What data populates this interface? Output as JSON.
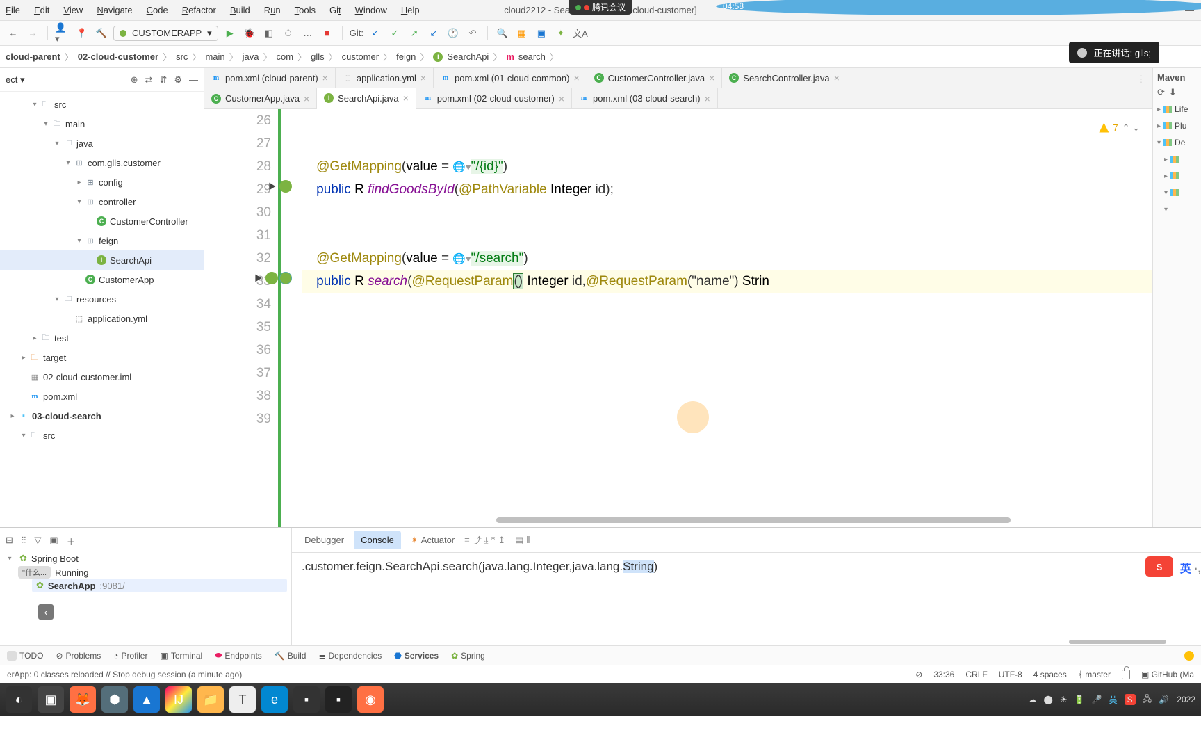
{
  "menu": {
    "file": "File",
    "edit": "Edit",
    "view": "View",
    "navigate": "Navigate",
    "code": "Code",
    "refactor": "Refactor",
    "build": "Build",
    "run": "Run",
    "tools": "Tools",
    "git": "Git",
    "window": "Window",
    "help": "Help"
  },
  "window_title": "cloud2212 - SearchApi.java [02-cloud-customer]",
  "overlay": {
    "text": "腾讯会议"
  },
  "mic_bar": "正在讲话: glls;",
  "time_badge": "04:58",
  "run_config": "CUSTOMERAPP",
  "git_label": "Git:",
  "breadcrumb": [
    "cloud-parent",
    "02-cloud-customer",
    "src",
    "main",
    "java",
    "com",
    "glls",
    "customer",
    "feign",
    "SearchApi",
    "search"
  ],
  "project_dd": "ect",
  "tree": [
    {
      "d": 1,
      "tw": "▾",
      "icon": "folder",
      "label": "src",
      "bold": false
    },
    {
      "d": 2,
      "tw": "▾",
      "icon": "folder",
      "label": "main",
      "bold": false
    },
    {
      "d": 3,
      "tw": "▾",
      "icon": "folder",
      "label": "java",
      "bold": false
    },
    {
      "d": 4,
      "tw": "▾",
      "icon": "pkg",
      "label": "com.glls.customer",
      "bold": false
    },
    {
      "d": 5,
      "tw": "▸",
      "icon": "pkg",
      "label": "config",
      "bold": false
    },
    {
      "d": 5,
      "tw": "▾",
      "icon": "pkg",
      "label": "controller",
      "bold": false
    },
    {
      "d": 6,
      "tw": "",
      "icon": "class",
      "label": "CustomerController",
      "bold": false
    },
    {
      "d": 5,
      "tw": "▾",
      "icon": "pkg",
      "label": "feign",
      "bold": false
    },
    {
      "d": 6,
      "tw": "",
      "icon": "iface",
      "label": "SearchApi",
      "bold": false,
      "sel": true
    },
    {
      "d": 5,
      "tw": "",
      "icon": "class",
      "label": "CustomerApp",
      "bold": false
    },
    {
      "d": 3,
      "tw": "▾",
      "icon": "folder",
      "label": "resources",
      "bold": false
    },
    {
      "d": 4,
      "tw": "",
      "icon": "yml",
      "label": "application.yml",
      "bold": false
    },
    {
      "d": 1,
      "tw": "▸",
      "icon": "folder",
      "label": "test",
      "bold": false
    },
    {
      "d": 0,
      "tw": "▸",
      "icon": "target",
      "label": "target",
      "bold": false
    },
    {
      "d": 0,
      "tw": "",
      "icon": "iml",
      "label": "02-cloud-customer.iml",
      "bold": false
    },
    {
      "d": 0,
      "tw": "",
      "icon": "xml",
      "label": "pom.xml",
      "bold": false
    },
    {
      "d": -1,
      "tw": "▸",
      "icon": "module",
      "label": "03-cloud-search",
      "bold": true
    },
    {
      "d": 0,
      "tw": "▾",
      "icon": "folder",
      "label": "src",
      "bold": false
    }
  ],
  "tabs_row1": [
    {
      "icon": "xml",
      "label": "pom.xml (cloud-parent)"
    },
    {
      "icon": "yml",
      "label": "application.yml"
    },
    {
      "icon": "xml",
      "label": "pom.xml (01-cloud-common)"
    },
    {
      "icon": "class",
      "label": "CustomerController.java"
    },
    {
      "icon": "class",
      "label": "SearchController.java"
    }
  ],
  "tabs_row2": [
    {
      "icon": "class",
      "label": "CustomerApp.java"
    },
    {
      "icon": "iface",
      "label": "SearchApi.java",
      "active": true
    },
    {
      "icon": "xml",
      "label": "pom.xml (02-cloud-customer)"
    },
    {
      "icon": "xml",
      "label": "pom.xml (03-cloud-search)"
    }
  ],
  "hint_count": "7",
  "code": {
    "lines": [
      "26",
      "27",
      "28",
      "29",
      "30",
      "31",
      "32",
      "33",
      "34",
      "35",
      "36",
      "37",
      "38",
      "39"
    ],
    "l28": {
      "ann": "@GetMapping",
      "par": "(",
      "val": "value = ",
      "url": "\"/{id}\"",
      "end": ")"
    },
    "l29": {
      "pub": "public",
      "r": "R",
      "m": "findGoodsById",
      "pv": "@PathVariable",
      "t": "Integer",
      "p": "id",
      "end": ");"
    },
    "l32": {
      "ann": "@GetMapping",
      "par": "(",
      "val": "value = ",
      "url": "\"/search\"",
      "end": ")"
    },
    "l33": {
      "pub": "public",
      "r": "R",
      "m": "search",
      "rp1": "@RequestParam",
      "paren": "()",
      "t1": "Integer",
      "p1": "id",
      "rp2": "@RequestParam",
      "n": "(\"name\")",
      "t2": "Strin"
    }
  },
  "maven": {
    "title": "Maven",
    "items": [
      "Life",
      "Plu",
      "De"
    ]
  },
  "run_panel": {
    "spring": "Spring Boot",
    "running": "Running",
    "gray": "\"什么...",
    "app": "SearchApp",
    "port": ":9081/"
  },
  "console_tabs": {
    "debugger": "Debugger",
    "console": "Console",
    "actuator": "Actuator"
  },
  "console_line": ".customer.feign.SearchApi.search(java.lang.Integer,java.lang.",
  "console_hl": "String",
  "console_end": ")",
  "status_tabs": [
    "TODO",
    "Problems",
    "Profiler",
    "Terminal",
    "Endpoints",
    "Build",
    "Dependencies",
    "Services",
    "Spring"
  ],
  "status_msg": "erApp: 0 classes reloaded // Stop debug session (a minute ago)",
  "status_right": {
    "pos": "33:36",
    "le": "CRLF",
    "enc": "UTF-8",
    "ind": "4 spaces",
    "branch": "master",
    "gh": "GitHub (Ma"
  },
  "taskbar_time": "2022",
  "ime": "英"
}
